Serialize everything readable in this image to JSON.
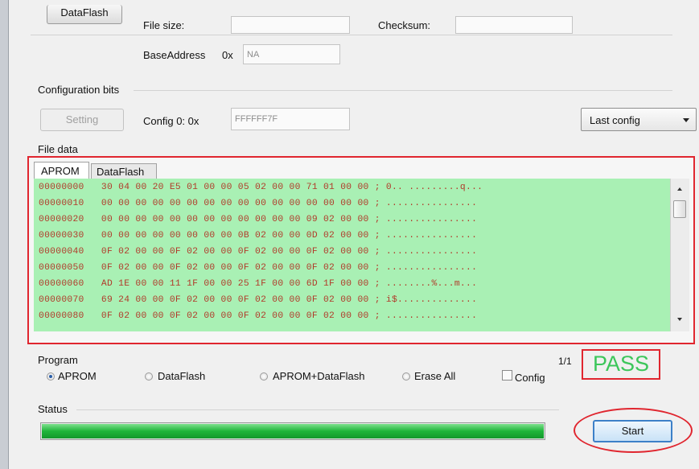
{
  "top": {
    "dataflash_button": "DataFlash",
    "file_size_label": "File size:",
    "checksum_label": "Checksum:",
    "base_address_label": "BaseAddress",
    "base_address_prefix": "0x",
    "base_address_value": "NA"
  },
  "config": {
    "group_label": "Configuration bits",
    "setting_button": "Setting",
    "config0_label": "Config 0: 0x",
    "config0_value": "FFFFFF7F",
    "dropdown_value": "Last config"
  },
  "file_data": {
    "group_label": "File data",
    "tabs": [
      "APROM",
      "DataFlash"
    ],
    "rows": [
      {
        "addr": "00000000",
        "bytes": "30 04 00 20 E5 01 00 00 05 02 00 00 71 01 00 00",
        "ascii": "; 0.. .........q..."
      },
      {
        "addr": "00000010",
        "bytes": "00 00 00 00 00 00 00 00 00 00 00 00 00 00 00 00",
        "ascii": "; ................"
      },
      {
        "addr": "00000020",
        "bytes": "00 00 00 00 00 00 00 00 00 00 00 00 09 02 00 00",
        "ascii": "; ................"
      },
      {
        "addr": "00000030",
        "bytes": "00 00 00 00 00 00 00 00 0B 02 00 00 0D 02 00 00",
        "ascii": "; ................"
      },
      {
        "addr": "00000040",
        "bytes": "0F 02 00 00 0F 02 00 00 0F 02 00 00 0F 02 00 00",
        "ascii": "; ................"
      },
      {
        "addr": "00000050",
        "bytes": "0F 02 00 00 0F 02 00 00 0F 02 00 00 0F 02 00 00",
        "ascii": "; ................"
      },
      {
        "addr": "00000060",
        "bytes": "AD 1E 00 00 11 1F 00 00 25 1F 00 00 6D 1F 00 00",
        "ascii": "; ........%...m..."
      },
      {
        "addr": "00000070",
        "bytes": "69 24 00 00 0F 02 00 00 0F 02 00 00 0F 02 00 00",
        "ascii": "; i$.............."
      },
      {
        "addr": "00000080",
        "bytes": "0F 02 00 00 0F 02 00 00 0F 02 00 00 0F 02 00 00",
        "ascii": "; ................"
      }
    ]
  },
  "program": {
    "group_label": "Program",
    "options": [
      "APROM",
      "DataFlash",
      "APROM+DataFlash",
      "Erase All"
    ],
    "selected": "APROM",
    "config_checkbox_label": "Config",
    "counter": "1/1",
    "result": "PASS"
  },
  "status": {
    "group_label": "Status",
    "progress": 1.0,
    "start_button": "Start"
  },
  "colors": {
    "hex_background": "#a9f0b4",
    "hex_text": "#b13a2a",
    "highlight_red": "#e0262f",
    "pass_green": "#3cc65a",
    "progress_green": "#1fb53a"
  },
  "icons": {
    "dropdown_arrow": "chevron-down-icon",
    "scroll_up": "triangle-up-icon",
    "scroll_down": "triangle-down-icon"
  }
}
